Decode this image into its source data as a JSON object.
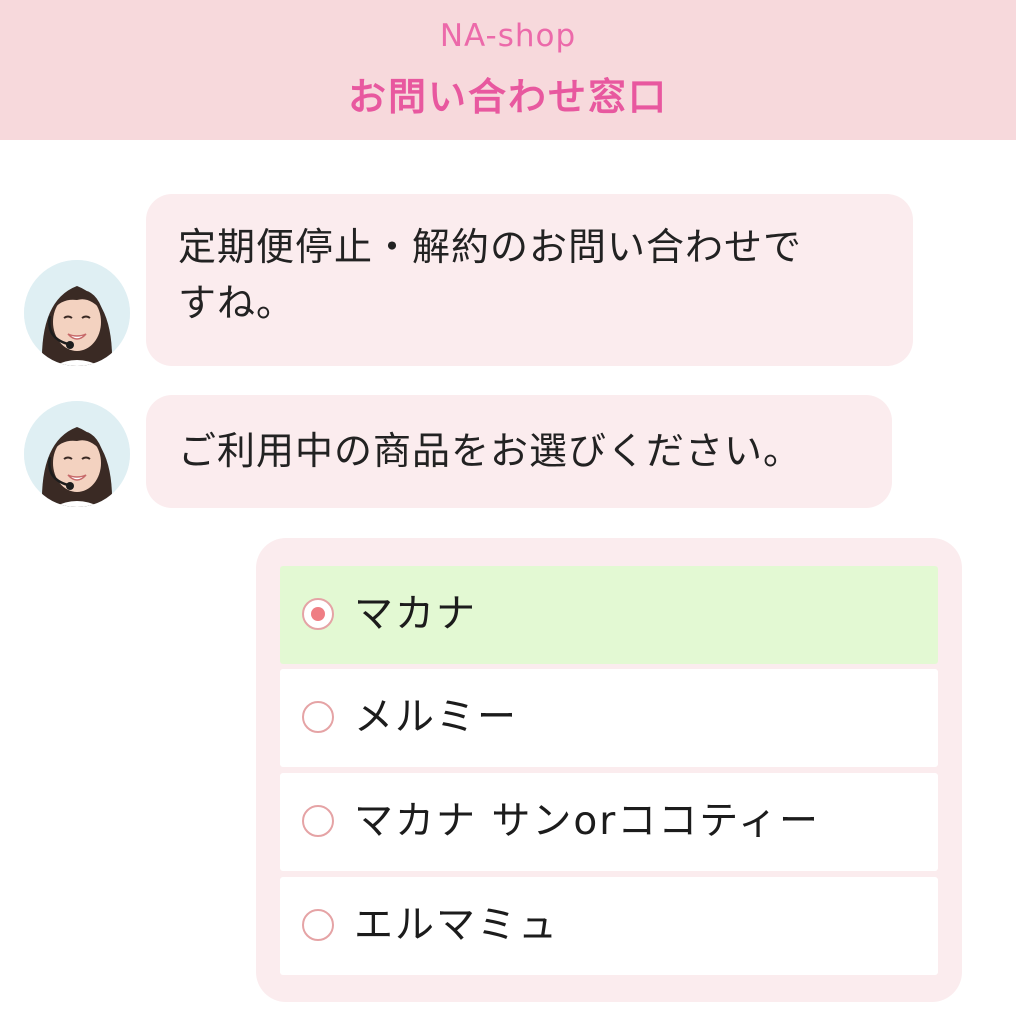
{
  "header": {
    "shop_name": "NA-shop",
    "title": "お問い合わせ窓口"
  },
  "colors": {
    "header_bg": "#f7d9dc",
    "accent_pink": "#e8589f",
    "bubble_bg": "#fbecee",
    "selected_bg": "#e3f9d3",
    "radio_border": "#e5a3a5",
    "radio_dot": "#ef7e84"
  },
  "messages": [
    {
      "sender_icon": "operator-avatar",
      "lines": [
        "定期便停止・解約のお問い合わせで",
        "すね。"
      ]
    },
    {
      "sender_icon": "operator-avatar",
      "lines": [
        "ご利用中の商品をお選びください。"
      ]
    }
  ],
  "options": [
    {
      "label": "マカナ",
      "selected": true
    },
    {
      "label": "メルミー",
      "selected": false
    },
    {
      "label": "マカナ サンorココティー",
      "selected": false
    },
    {
      "label": "エルマミュ",
      "selected": false
    }
  ]
}
